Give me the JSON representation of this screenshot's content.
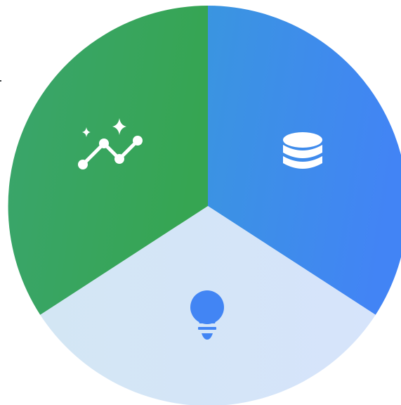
{
  "diagram": {
    "type": "segmented-circle",
    "segments": [
      {
        "id": "data",
        "icon": "database-icon",
        "colors": {
          "from": "#3a95e0",
          "to": "#4284f5"
        },
        "icon_color": "#ffffff"
      },
      {
        "id": "ideas",
        "icon": "lightbulb-icon",
        "colors": {
          "from": "#d3e6f4",
          "to": "#d6e4fb"
        },
        "icon_color": "#4285f4"
      },
      {
        "id": "analytics",
        "icon": "sparkle-line-chart-icon",
        "colors": {
          "from": "#3aa56d",
          "to": "#36a552"
        },
        "icon_color": "#ffffff"
      }
    ]
  }
}
